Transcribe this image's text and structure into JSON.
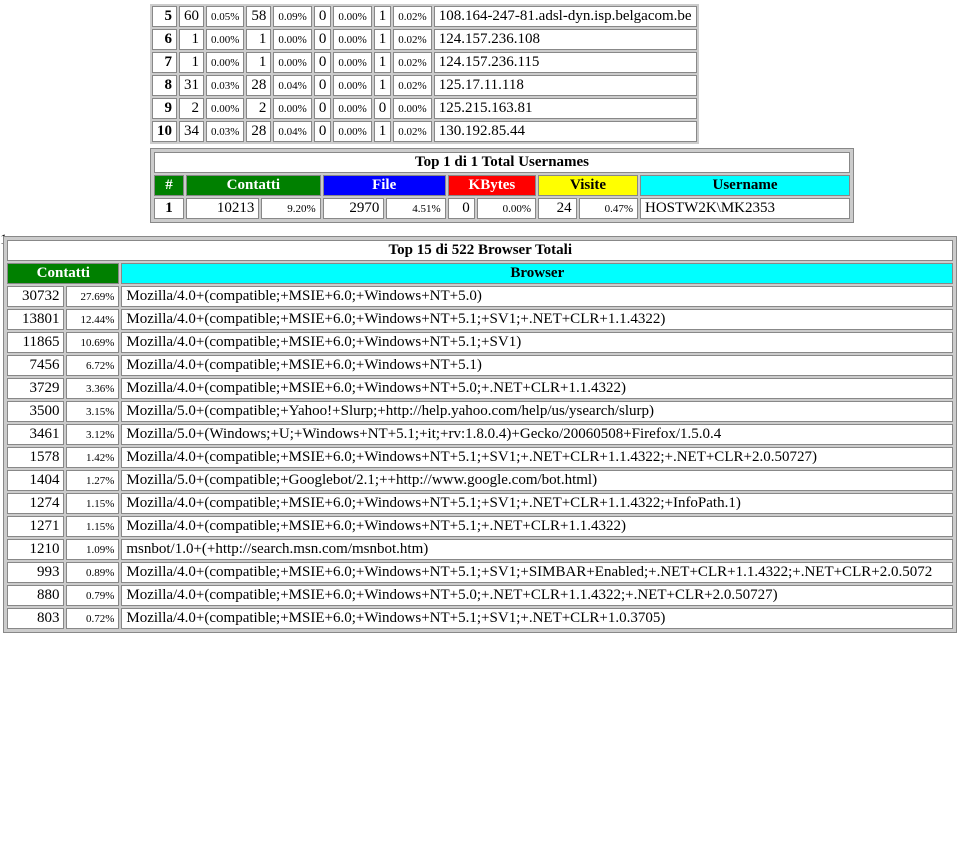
{
  "sites": {
    "rows": [
      {
        "rk": "5",
        "c1": "60",
        "p1": "0.05%",
        "c2": "58",
        "p2": "0.09%",
        "c3": "0",
        "p3": "0.00%",
        "c4": "1",
        "p4": "0.02%",
        "host": "108.164-247-81.adsl-dyn.isp.belgacom.be"
      },
      {
        "rk": "6",
        "c1": "1",
        "p1": "0.00%",
        "c2": "1",
        "p2": "0.00%",
        "c3": "0",
        "p3": "0.00%",
        "c4": "1",
        "p4": "0.02%",
        "host": "124.157.236.108"
      },
      {
        "rk": "7",
        "c1": "1",
        "p1": "0.00%",
        "c2": "1",
        "p2": "0.00%",
        "c3": "0",
        "p3": "0.00%",
        "c4": "1",
        "p4": "0.02%",
        "host": "124.157.236.115"
      },
      {
        "rk": "8",
        "c1": "31",
        "p1": "0.03%",
        "c2": "28",
        "p2": "0.04%",
        "c3": "0",
        "p3": "0.00%",
        "c4": "1",
        "p4": "0.02%",
        "host": "125.17.11.118"
      },
      {
        "rk": "9",
        "c1": "2",
        "p1": "0.00%",
        "c2": "2",
        "p2": "0.00%",
        "c3": "0",
        "p3": "0.00%",
        "c4": "0",
        "p4": "0.00%",
        "host": "125.215.163.81"
      },
      {
        "rk": "10",
        "c1": "34",
        "p1": "0.03%",
        "c2": "28",
        "p2": "0.04%",
        "c3": "0",
        "p3": "0.00%",
        "c4": "1",
        "p4": "0.02%",
        "host": "130.192.85.44"
      }
    ]
  },
  "usernames": {
    "title": "Top 1 di 1 Total Usernames",
    "headers": {
      "rk": "#",
      "contatti": "Contatti",
      "file": "File",
      "kbytes": "KBytes",
      "visite": "Visite",
      "username": "Username"
    },
    "rows": [
      {
        "rk": "1",
        "c1": "10213",
        "p1": "9.20%",
        "c2": "2970",
        "p2": "4.51%",
        "c3": "0",
        "p3": "0.00%",
        "c4": "24",
        "p4": "0.47%",
        "user": "HOSTW2K\\MK2353"
      }
    ]
  },
  "browsers": {
    "title": "Top 15 di 522 Browser Totali",
    "headers": {
      "contatti": "Contatti",
      "browser": "Browser"
    },
    "leftcol": "1",
    "rows": [
      {
        "c": "30732",
        "p": "27.69%",
        "b": "Mozilla/4.0+(compatible;+MSIE+6.0;+Windows+NT+5.0)"
      },
      {
        "c": "13801",
        "p": "12.44%",
        "b": "Mozilla/4.0+(compatible;+MSIE+6.0;+Windows+NT+5.1;+SV1;+.NET+CLR+1.1.4322)"
      },
      {
        "c": "11865",
        "p": "10.69%",
        "b": "Mozilla/4.0+(compatible;+MSIE+6.0;+Windows+NT+5.1;+SV1)"
      },
      {
        "c": "7456",
        "p": "6.72%",
        "b": "Mozilla/4.0+(compatible;+MSIE+6.0;+Windows+NT+5.1)"
      },
      {
        "c": "3729",
        "p": "3.36%",
        "b": "Mozilla/4.0+(compatible;+MSIE+6.0;+Windows+NT+5.0;+.NET+CLR+1.1.4322)"
      },
      {
        "c": "3500",
        "p": "3.15%",
        "b": "Mozilla/5.0+(compatible;+Yahoo!+Slurp;+http://help.yahoo.com/help/us/ysearch/slurp)"
      },
      {
        "c": "3461",
        "p": "3.12%",
        "b": "Mozilla/5.0+(Windows;+U;+Windows+NT+5.1;+it;+rv:1.8.0.4)+Gecko/20060508+Firefox/1.5.0.4"
      },
      {
        "c": "1578",
        "p": "1.42%",
        "b": "Mozilla/4.0+(compatible;+MSIE+6.0;+Windows+NT+5.1;+SV1;+.NET+CLR+1.1.4322;+.NET+CLR+2.0.50727)"
      },
      {
        "c": "1404",
        "p": "1.27%",
        "b": "Mozilla/5.0+(compatible;+Googlebot/2.1;++http://www.google.com/bot.html)"
      },
      {
        "c": "1274",
        "p": "1.15%",
        "b": "Mozilla/4.0+(compatible;+MSIE+6.0;+Windows+NT+5.1;+SV1;+.NET+CLR+1.1.4322;+InfoPath.1)"
      },
      {
        "c": "1271",
        "p": "1.15%",
        "b": "Mozilla/4.0+(compatible;+MSIE+6.0;+Windows+NT+5.1;+.NET+CLR+1.1.4322)"
      },
      {
        "c": "1210",
        "p": "1.09%",
        "b": "msnbot/1.0+(+http://search.msn.com/msnbot.htm)"
      },
      {
        "c": "993",
        "p": "0.89%",
        "b": "Mozilla/4.0+(compatible;+MSIE+6.0;+Windows+NT+5.1;+SV1;+SIMBAR+Enabled;+.NET+CLR+1.1.4322;+.NET+CLR+2.0.5072"
      },
      {
        "c": "880",
        "p": "0.79%",
        "b": "Mozilla/4.0+(compatible;+MSIE+6.0;+Windows+NT+5.0;+.NET+CLR+1.1.4322;+.NET+CLR+2.0.50727)"
      },
      {
        "c": "803",
        "p": "0.72%",
        "b": "Mozilla/4.0+(compatible;+MSIE+6.0;+Windows+NT+5.1;+SV1;+.NET+CLR+1.0.3705)"
      }
    ]
  }
}
